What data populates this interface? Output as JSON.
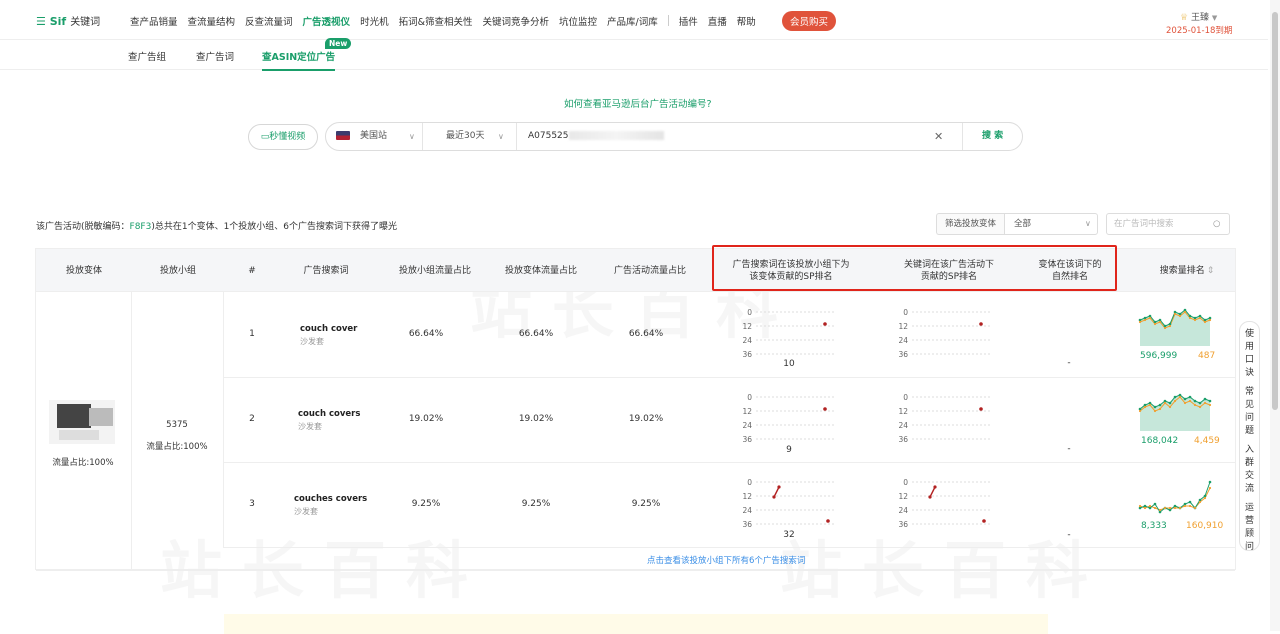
{
  "header": {
    "logo": "Sif",
    "logo_sub": "关键词",
    "nav": [
      "查产品销量",
      "查流量结构",
      "反查流量词",
      "广告透视仪",
      "时光机",
      "拓词&筛查相关性",
      "关键词竞争分析",
      "坑位监控",
      "产品库/词库"
    ],
    "nav_active": "广告透视仪",
    "nav2": [
      "插件",
      "直播",
      "帮助"
    ],
    "vip_label": "会员购买",
    "user_name": "王臻",
    "expiry": "2025-01-18到期"
  },
  "subnav": {
    "tabs": [
      "查广告组",
      "查广告词",
      "查ASIN定位广告"
    ],
    "active": "查ASIN定位广告",
    "new_badge": "New"
  },
  "search": {
    "help_link": "如何查看亚马逊后台广告活动编号?",
    "video_btn": "秒懂视频",
    "marketplace": "美国站",
    "period": "最近30天",
    "query_value": "A075525",
    "search_btn": "搜 索"
  },
  "summary": {
    "prefix": "该广告活动(脱敏编码：",
    "code": "F8F3",
    "suffix": ")总共在1个变体、1个投放小组、6个广告搜索词下获得了曝光"
  },
  "filter": {
    "label": "筛选投放变体",
    "value": "全部",
    "search_placeholder": "在广告词中搜索"
  },
  "table": {
    "headers": {
      "variant": "投放变体",
      "group": "投放小组",
      "idx": "#",
      "keyword": "广告搜索词",
      "group_share": "投放小组流量占比",
      "variant_share": "投放变体流量占比",
      "campaign_share": "广告活动流量占比",
      "sp_rank_group_l1": "广告搜索词在该投放小组下为",
      "sp_rank_group_l2": "该变体贡献的SP排名",
      "sp_rank_campaign_l1": "关键词在该广告活动下",
      "sp_rank_campaign_l2": "贡献的SP排名",
      "natural_l1": "变体在该词下的",
      "natural_l2": "自然排名",
      "search_volume_rank": "搜索量排名"
    },
    "variant_share": "流量占比:100%",
    "group_id": "5375",
    "group_share": "流量占比:100%",
    "rows": [
      {
        "idx": "1",
        "keyword": "couch cover",
        "keyword_cn": "沙发套",
        "group_share": "66.64%",
        "variant_share": "66.64%",
        "campaign_share": "66.64%",
        "sp_rank_label": "10",
        "natural": "-",
        "vol_left": "596,999",
        "vol_right": "487"
      },
      {
        "idx": "2",
        "keyword": "couch covers",
        "keyword_cn": "沙发套",
        "group_share": "19.02%",
        "variant_share": "19.02%",
        "campaign_share": "19.02%",
        "sp_rank_label": "9",
        "natural": "-",
        "vol_left": "168,042",
        "vol_right": "4,459"
      },
      {
        "idx": "3",
        "keyword": "couches covers",
        "keyword_cn": "沙发套",
        "group_share": "9.25%",
        "variant_share": "9.25%",
        "campaign_share": "9.25%",
        "sp_rank_label": "32",
        "natural": "-",
        "vol_left": "8,333",
        "vol_right": "160,910"
      }
    ],
    "axis_ticks": [
      "0",
      "12",
      "24",
      "36"
    ],
    "more_link": "点击查看该投放小组下所有6个广告搜索词"
  },
  "sidebar": [
    "使用口诀",
    "常见问题",
    "入群交流",
    "运营顾问"
  ],
  "colors": {
    "brand": "#1a9e6a",
    "vip": "#e0533b",
    "highlight_box": "#e0251b",
    "link": "#3a8ee6",
    "trend_green": "#1a9e6a",
    "trend_orange": "#f0a030",
    "rank_dot": "#b22222"
  }
}
